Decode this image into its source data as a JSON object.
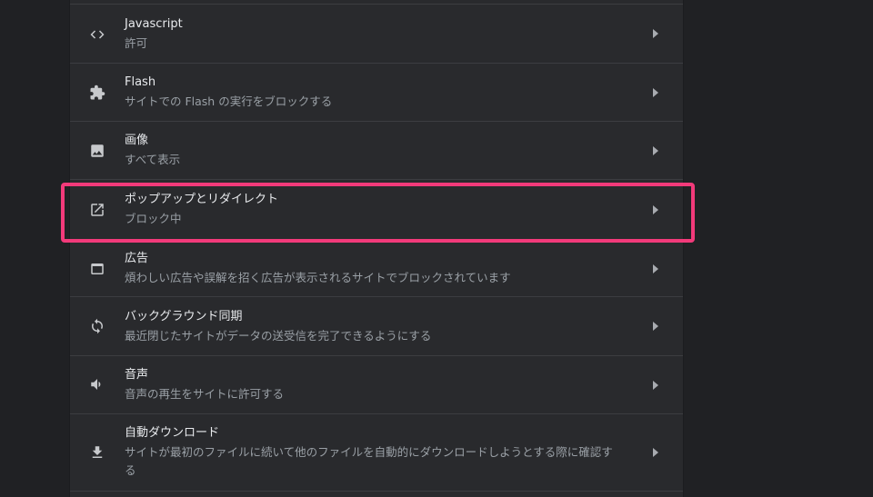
{
  "colors": {
    "background": "#202124",
    "panel": "#292a2d",
    "divider": "#3c3d41",
    "title_text": "#e8eaed",
    "subtitle_text": "#9aa0a6",
    "highlight_border": "#f23a7a"
  },
  "settings": {
    "items": [
      {
        "icon": "code-brackets-icon",
        "title": "Javascript",
        "subtitle": "許可"
      },
      {
        "icon": "puzzle-piece-icon",
        "title": "Flash",
        "subtitle": "サイトでの Flash の実行をブロックする"
      },
      {
        "icon": "image-icon",
        "title": "画像",
        "subtitle": "すべて表示"
      },
      {
        "icon": "open-in-new-icon",
        "title": "ポップアップとリダイレクト",
        "subtitle": "ブロック中"
      },
      {
        "icon": "browser-window-icon",
        "title": "広告",
        "subtitle": "煩わしい広告や誤解を招く広告が表示されるサイトでブロックされています"
      },
      {
        "icon": "sync-icon",
        "title": "バックグラウンド同期",
        "subtitle": "最近閉じたサイトがデータの送受信を完了できるようにする"
      },
      {
        "icon": "speaker-icon",
        "title": "音声",
        "subtitle": "音声の再生をサイトに許可する"
      },
      {
        "icon": "download-icon",
        "title": "自動ダウンロード",
        "subtitle": "サイトが最初のファイルに続いて他のファイルを自動的にダウンロードしようとする際に確認する"
      }
    ]
  }
}
